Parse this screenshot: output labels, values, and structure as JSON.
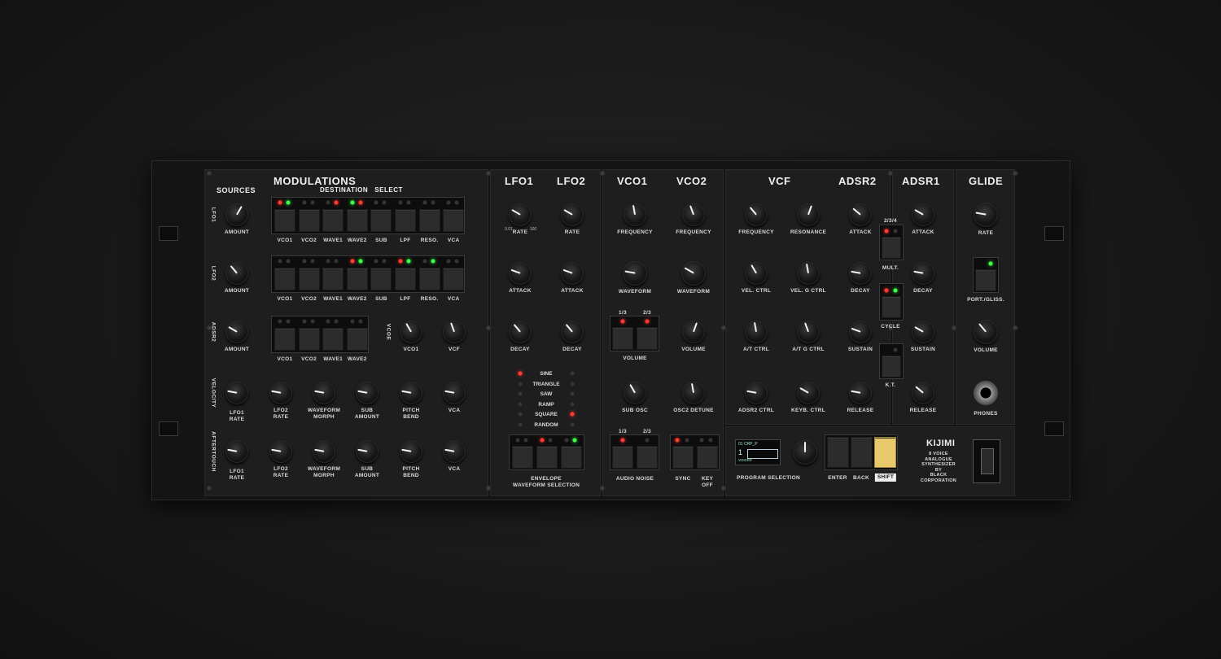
{
  "brand": {
    "name": "KIJIMI",
    "desc": "8 VOICE\nANALOGUE\nSYNTHESIZER\nBY\nBLACK\nCORPORATION"
  },
  "modulations": {
    "title": "MODULATIONS",
    "sources_label": "SOURCES",
    "dest_label": "DESTINATION   SELECT",
    "row_sources": [
      "LFO1",
      "LFO2",
      "ADSR2",
      "VELOCITY",
      "AFTERTOUCH"
    ],
    "amount_label": "AMOUNT",
    "dest8": [
      "VCO1",
      "VCO2",
      "WAVE1",
      "WAVE2",
      "SUB",
      "LPF",
      "RESO.",
      "VCA"
    ],
    "dest4": [
      "VCO1",
      "VCO2",
      "WAVE1",
      "WAVE2"
    ],
    "vcoe_label": "VCOE",
    "adsr_knobs": [
      "VCO1",
      "VCF"
    ],
    "perf_knobs": [
      "LFO1\nRATE",
      "LFO2\nRATE",
      "WAVEFORM\nMORPH",
      "SUB\nAMOUNT",
      "PITCH\nBEND",
      "VCA"
    ]
  },
  "lfo": {
    "titles": [
      "LFO1",
      "LFO2"
    ],
    "knobs": [
      "RATE",
      "ATTACK",
      "DECAY"
    ],
    "waveforms": [
      "SINE",
      "TRIANGLE",
      "SAW",
      "RAMP",
      "SQUARE",
      "RANDOM"
    ],
    "env_label": "ENVELOPE\nWAVEFORM SELECTION",
    "scale_lo": "0.01",
    "scale_hi": "100"
  },
  "vco": {
    "titles": [
      "VCO1",
      "VCO2"
    ],
    "frequency": "FREQUENCY",
    "waveform": "WAVEFORM",
    "volume": "VOLUME",
    "sub_osc": "SUB OSC",
    "detune": "OSC2 DETUNE",
    "sub_buttons": [
      "1/3",
      "2/3"
    ],
    "noise_label": "AUDIO NOISE",
    "sync": "SYNC",
    "keyoff": "KEY\nOFF"
  },
  "vcf": {
    "title": "VCF",
    "knobs": [
      "FREQUENCY",
      "RESONANCE",
      "VEL. CTRL",
      "VEL. G CTRL",
      "A/T CTRL",
      "A/T G CTRL",
      "ADSR2 CTRL",
      "KEYB. CTRL"
    ]
  },
  "adsr2": {
    "title": "ADSR2",
    "knobs": [
      "ATTACK",
      "DECAY",
      "SUSTAIN",
      "RELEASE"
    ]
  },
  "adsr1": {
    "title": "ADSR1",
    "knobs": [
      "ATTACK",
      "DECAY",
      "SUSTAIN",
      "RELEASE"
    ]
  },
  "env_buttons": [
    "2/3/4",
    "MULT.",
    "CYCLE",
    "K.T."
  ],
  "glide": {
    "title": "GLIDE",
    "rate": "RATE",
    "port": "PORT./GLISS.",
    "volume": "VOLUME",
    "phones": "PHONES"
  },
  "program": {
    "label": "PROGRAM SELECTION",
    "enter": "ENTER",
    "back": "BACK",
    "shift": "SHIFT",
    "oled_top": "01  CRP_P",
    "oled_num": "1",
    "oled_voice": "VOICE0"
  },
  "colors": {
    "panel": "#1e1e1e",
    "led_red": "#ff3b2f",
    "led_green": "#3dff4a",
    "shift": "#e7c86a"
  }
}
